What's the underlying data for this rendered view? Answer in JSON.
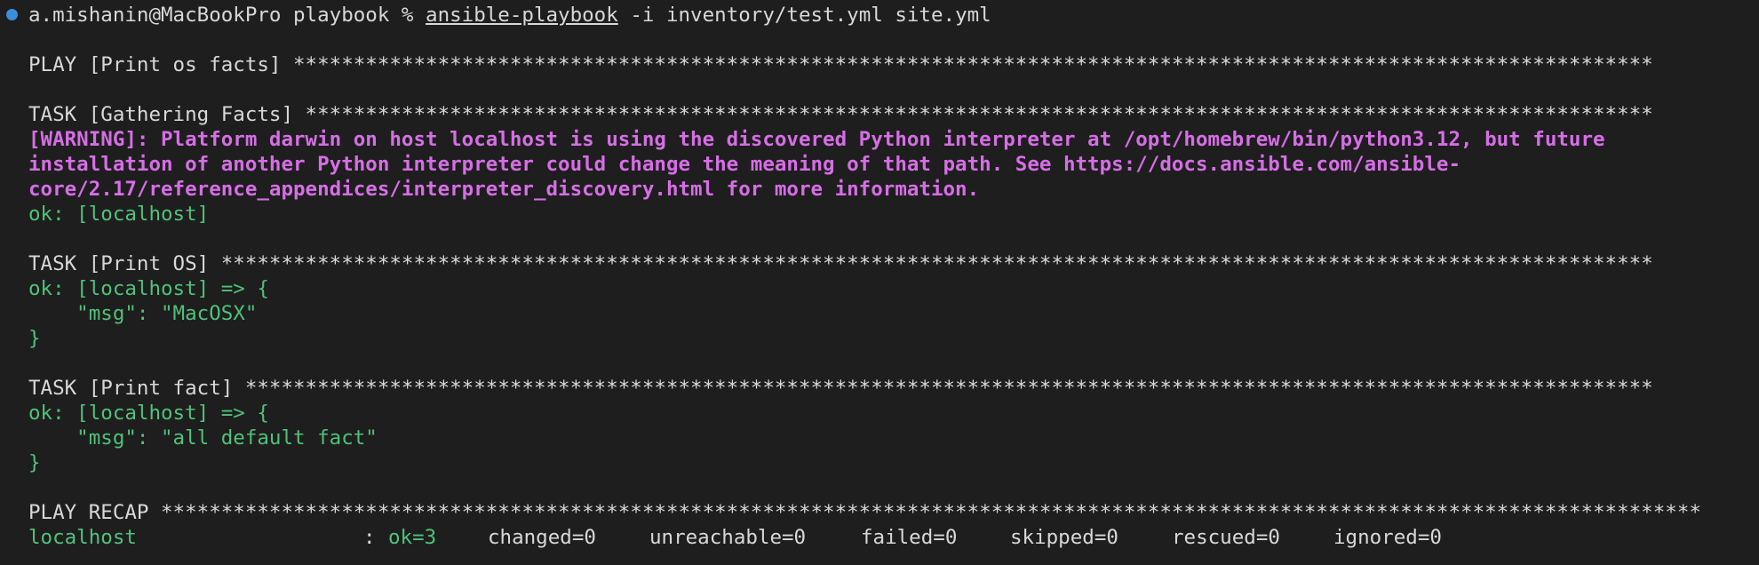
{
  "terminal": {
    "status_color": "#3b8fd8",
    "prompt": {
      "user_host": "a.mishanin@MacBookPro playbook %",
      "command": "ansible-playbook",
      "args": "-i inventory/test.yml site.yml"
    },
    "play_header": "PLAY [Print os facts] *****************************************************************************************************************",
    "task_gather_header": "TASK [Gathering Facts] ****************************************************************************************************************",
    "warning_lines": [
      "[WARNING]: Platform darwin on host localhost is using the discovered Python interpreter at /opt/homebrew/bin/python3.12, but future",
      "installation of another Python interpreter could change the meaning of that path. See https://docs.ansible.com/ansible-",
      "core/2.17/reference_appendices/interpreter_discovery.html for more information."
    ],
    "gather_ok": "ok: [localhost]",
    "task_os_header": "TASK [Print OS] ***********************************************************************************************************************",
    "task_os_output": [
      "ok: [localhost] => {",
      "    \"msg\": \"MacOSX\"",
      "}"
    ],
    "task_fact_header": "TASK [Print fact] *********************************************************************************************************************",
    "task_fact_output": [
      "ok: [localhost] => {",
      "    \"msg\": \"all default fact\"",
      "}"
    ],
    "recap_header": "PLAY RECAP ********************************************************************************************************************************",
    "recap": {
      "host": "localhost",
      "separator": ":",
      "ok": "ok=3",
      "changed": "changed=0",
      "unreachable": "unreachable=0",
      "failed": "failed=0",
      "skipped": "skipped=0",
      "rescued": "rescued=0",
      "ignored": "ignored=0"
    }
  }
}
